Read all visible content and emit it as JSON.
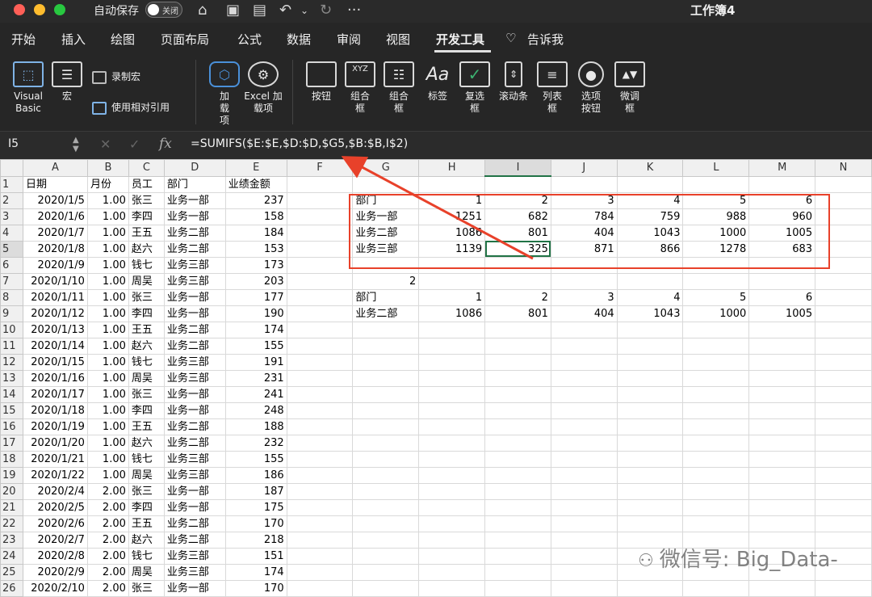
{
  "titlebar": {
    "autosave_label": "自动保存",
    "autosave_state": "关闭",
    "title": "工作簿4",
    "more": "···"
  },
  "tabs": [
    "开始",
    "插入",
    "绘图",
    "页面布局",
    "公式",
    "数据",
    "审阅",
    "视图",
    "开发工具",
    "告诉我"
  ],
  "active_tab": "开发工具",
  "ribbon": {
    "vb_label": "Visual Basic",
    "macro_label": "宏",
    "record_macro": "录制宏",
    "relative_ref": "使用相对引用",
    "addin_label": "加载项",
    "excel_addin_label": "Excel 加载项",
    "controls": [
      "按钮",
      "组合框",
      "组合框",
      "标签",
      "复选框",
      "滚动条",
      "列表框",
      "选项按钮",
      "微调框"
    ]
  },
  "formula_bar": {
    "name_box": "I5",
    "fx": "fx",
    "formula": "=SUMIFS($E:$E,$D:$D,$G5,$B:$B,I$2)"
  },
  "columns": [
    "A",
    "B",
    "C",
    "D",
    "E",
    "F",
    "G",
    "H",
    "I",
    "J",
    "K",
    "L",
    "M",
    "N"
  ],
  "rows": [
    {
      "n": "1",
      "A": "日期",
      "B": "月份",
      "C": "员工",
      "D": "部门",
      "E": "业绩金额",
      "G": "",
      "H": "",
      "I": "",
      "J": "",
      "K": "",
      "L": "",
      "M": ""
    },
    {
      "n": "2",
      "A": "2020/1/5",
      "B": "1.00",
      "C": "张三",
      "D": "业务一部",
      "E": "237",
      "G": "部门",
      "H": "1",
      "I": "2",
      "J": "3",
      "K": "4",
      "L": "5",
      "M": "6"
    },
    {
      "n": "3",
      "A": "2020/1/6",
      "B": "1.00",
      "C": "李四",
      "D": "业务一部",
      "E": "158",
      "G": "业务一部",
      "H": "1251",
      "I": "682",
      "J": "784",
      "K": "759",
      "L": "988",
      "M": "960"
    },
    {
      "n": "4",
      "A": "2020/1/7",
      "B": "1.00",
      "C": "王五",
      "D": "业务二部",
      "E": "184",
      "G": "业务二部",
      "H": "1086",
      "I": "801",
      "J": "404",
      "K": "1043",
      "L": "1000",
      "M": "1005"
    },
    {
      "n": "5",
      "A": "2020/1/8",
      "B": "1.00",
      "C": "赵六",
      "D": "业务二部",
      "E": "153",
      "G": "业务三部",
      "H": "1139",
      "I": "325",
      "J": "871",
      "K": "866",
      "L": "1278",
      "M": "683"
    },
    {
      "n": "6",
      "A": "2020/1/9",
      "B": "1.00",
      "C": "钱七",
      "D": "业务三部",
      "E": "173",
      "G": "",
      "H": "",
      "I": "",
      "J": "",
      "K": "",
      "L": "",
      "M": ""
    },
    {
      "n": "7",
      "A": "2020/1/10",
      "B": "1.00",
      "C": "周吴",
      "D": "业务三部",
      "E": "203",
      "G": "2",
      "H": "",
      "I": "",
      "J": "",
      "K": "",
      "L": "",
      "M": ""
    },
    {
      "n": "8",
      "A": "2020/1/11",
      "B": "1.00",
      "C": "张三",
      "D": "业务一部",
      "E": "177",
      "G": "部门",
      "H": "1",
      "I": "2",
      "J": "3",
      "K": "4",
      "L": "5",
      "M": "6"
    },
    {
      "n": "9",
      "A": "2020/1/12",
      "B": "1.00",
      "C": "李四",
      "D": "业务一部",
      "E": "190",
      "G": "业务二部",
      "H": "1086",
      "I": "801",
      "J": "404",
      "K": "1043",
      "L": "1000",
      "M": "1005"
    },
    {
      "n": "10",
      "A": "2020/1/13",
      "B": "1.00",
      "C": "王五",
      "D": "业务二部",
      "E": "174"
    },
    {
      "n": "11",
      "A": "2020/1/14",
      "B": "1.00",
      "C": "赵六",
      "D": "业务二部",
      "E": "155"
    },
    {
      "n": "12",
      "A": "2020/1/15",
      "B": "1.00",
      "C": "钱七",
      "D": "业务三部",
      "E": "191"
    },
    {
      "n": "13",
      "A": "2020/1/16",
      "B": "1.00",
      "C": "周吴",
      "D": "业务三部",
      "E": "231"
    },
    {
      "n": "14",
      "A": "2020/1/17",
      "B": "1.00",
      "C": "张三",
      "D": "业务一部",
      "E": "241"
    },
    {
      "n": "15",
      "A": "2020/1/18",
      "B": "1.00",
      "C": "李四",
      "D": "业务一部",
      "E": "248"
    },
    {
      "n": "16",
      "A": "2020/1/19",
      "B": "1.00",
      "C": "王五",
      "D": "业务二部",
      "E": "188"
    },
    {
      "n": "17",
      "A": "2020/1/20",
      "B": "1.00",
      "C": "赵六",
      "D": "业务二部",
      "E": "232"
    },
    {
      "n": "18",
      "A": "2020/1/21",
      "B": "1.00",
      "C": "钱七",
      "D": "业务三部",
      "E": "155"
    },
    {
      "n": "19",
      "A": "2020/1/22",
      "B": "1.00",
      "C": "周吴",
      "D": "业务三部",
      "E": "186"
    },
    {
      "n": "20",
      "A": "2020/2/4",
      "B": "2.00",
      "C": "张三",
      "D": "业务一部",
      "E": "187"
    },
    {
      "n": "21",
      "A": "2020/2/5",
      "B": "2.00",
      "C": "李四",
      "D": "业务一部",
      "E": "175"
    },
    {
      "n": "22",
      "A": "2020/2/6",
      "B": "2.00",
      "C": "王五",
      "D": "业务二部",
      "E": "170"
    },
    {
      "n": "23",
      "A": "2020/2/7",
      "B": "2.00",
      "C": "赵六",
      "D": "业务二部",
      "E": "218"
    },
    {
      "n": "24",
      "A": "2020/2/8",
      "B": "2.00",
      "C": "钱七",
      "D": "业务三部",
      "E": "151"
    },
    {
      "n": "25",
      "A": "2020/2/9",
      "B": "2.00",
      "C": "周吴",
      "D": "业务三部",
      "E": "174"
    },
    {
      "n": "26",
      "A": "2020/2/10",
      "B": "2.00",
      "C": "张三",
      "D": "业务一部",
      "E": "170"
    }
  ],
  "selected_cell": {
    "row": "5",
    "col": "I"
  },
  "watermark": "微信号: Big_Data-",
  "colors": {
    "accent": "#217346",
    "highlight": "#e8412a"
  }
}
